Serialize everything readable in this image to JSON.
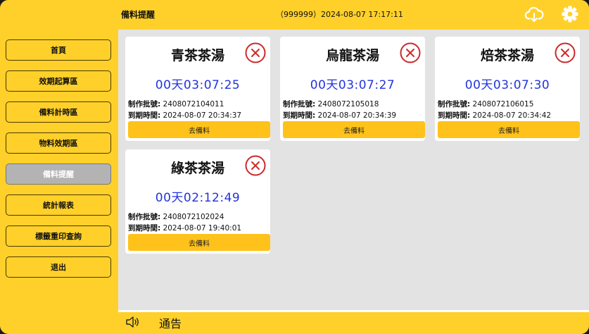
{
  "header": {
    "title": "備料提醒",
    "status": "（999999）2024-08-07 17:17:11"
  },
  "sidebar": {
    "items": [
      {
        "label": "首頁",
        "active": false
      },
      {
        "label": "效期起算區",
        "active": false
      },
      {
        "label": "備料計時區",
        "active": false
      },
      {
        "label": "物料效期區",
        "active": false
      },
      {
        "label": "備料提醒",
        "active": true
      },
      {
        "label": "統計報表",
        "active": false
      },
      {
        "label": "標籤重印查詢",
        "active": false
      },
      {
        "label": "退出",
        "active": false
      }
    ]
  },
  "cards": [
    {
      "title": "青茶茶湯",
      "timer": "00天03:07:25",
      "batch_label": "制作批號:",
      "batch": "2408072104011",
      "expire_label": "到期時間:",
      "expire": "2024-08-07 20:34:37",
      "button": "去備料"
    },
    {
      "title": "烏龍茶湯",
      "timer": "00天03:07:27",
      "batch_label": "制作批號:",
      "batch": "2408072105018",
      "expire_label": "到期時間:",
      "expire": "2024-08-07 20:34:39",
      "button": "去備料"
    },
    {
      "title": "焙茶茶湯",
      "timer": "00天03:07:30",
      "batch_label": "制作批號:",
      "batch": "2408072106015",
      "expire_label": "到期時間:",
      "expire": "2024-08-07 20:34:42",
      "button": "去備料"
    },
    {
      "title": "綠茶茶湯",
      "timer": "00天02:12:49",
      "batch_label": "制作批號:",
      "batch": "2408072102024",
      "expire_label": "到期時間:",
      "expire": "2024-08-07 19:40:01",
      "button": "去備料"
    }
  ],
  "footer": {
    "notice_label": "通告"
  },
  "icons": {
    "cloud": "cloud-download-icon",
    "settings": "gear-icon",
    "close": "close-circle-icon",
    "speaker": "speaker-icon"
  },
  "colors": {
    "brand": "#ffd02a",
    "button": "#ffc21a",
    "timer": "#2233dd",
    "close": "#cc2a2a",
    "active_nav": "#b3b3b3"
  }
}
